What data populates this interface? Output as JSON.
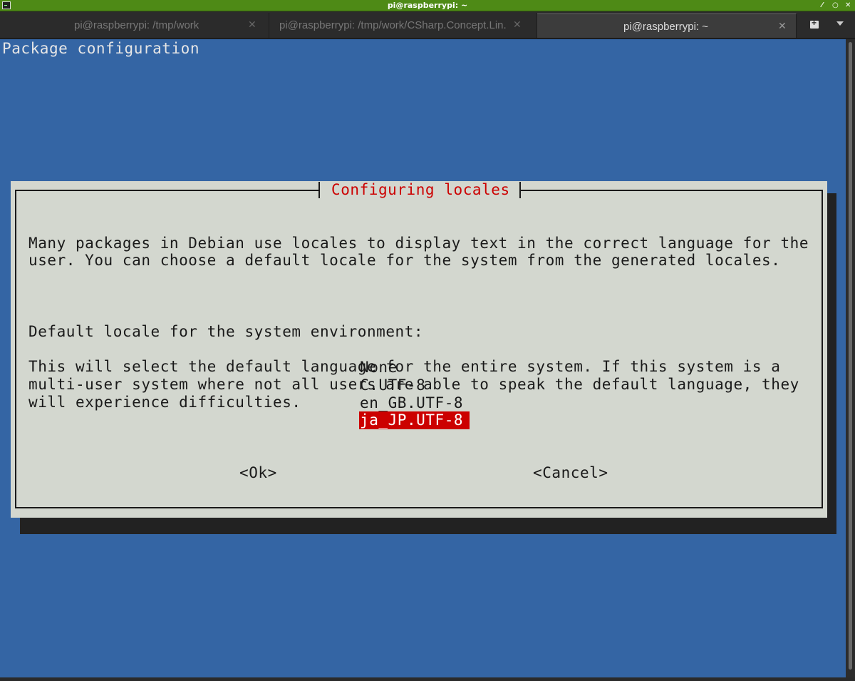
{
  "window": {
    "title": "pi@raspberrypi: ~",
    "controls": [
      "⁄",
      "○",
      "✕"
    ]
  },
  "tabs": [
    {
      "label": "pi@raspberrypi: /tmp/work",
      "active": false
    },
    {
      "label": "pi@raspberrypi: /tmp/work/CSharp.Concept.Lin...",
      "active": false
    },
    {
      "label": "pi@raspberrypi: ~",
      "active": true
    }
  ],
  "tab_close_glyph": "✕",
  "terminal": {
    "header": "Package configuration",
    "background_color": "#3465a4"
  },
  "dialog": {
    "title": "Configuring locales",
    "paragraphs": [
      "Many packages in Debian use locales to display text in the correct language for the\nuser. You can choose a default locale for the system from the generated locales.",
      "This will select the default language for the entire system. If this system is a\nmulti-user system where not all users are able to speak the default language, they\nwill experience difficulties."
    ],
    "prompt": "Default locale for the system environment:",
    "options": [
      "None",
      "C.UTF-8",
      "en_GB.UTF-8",
      "ja_JP.UTF-8"
    ],
    "selected_index": 3,
    "ok_label": "<Ok>",
    "cancel_label": "<Cancel>",
    "accent_color": "#cc0000"
  }
}
